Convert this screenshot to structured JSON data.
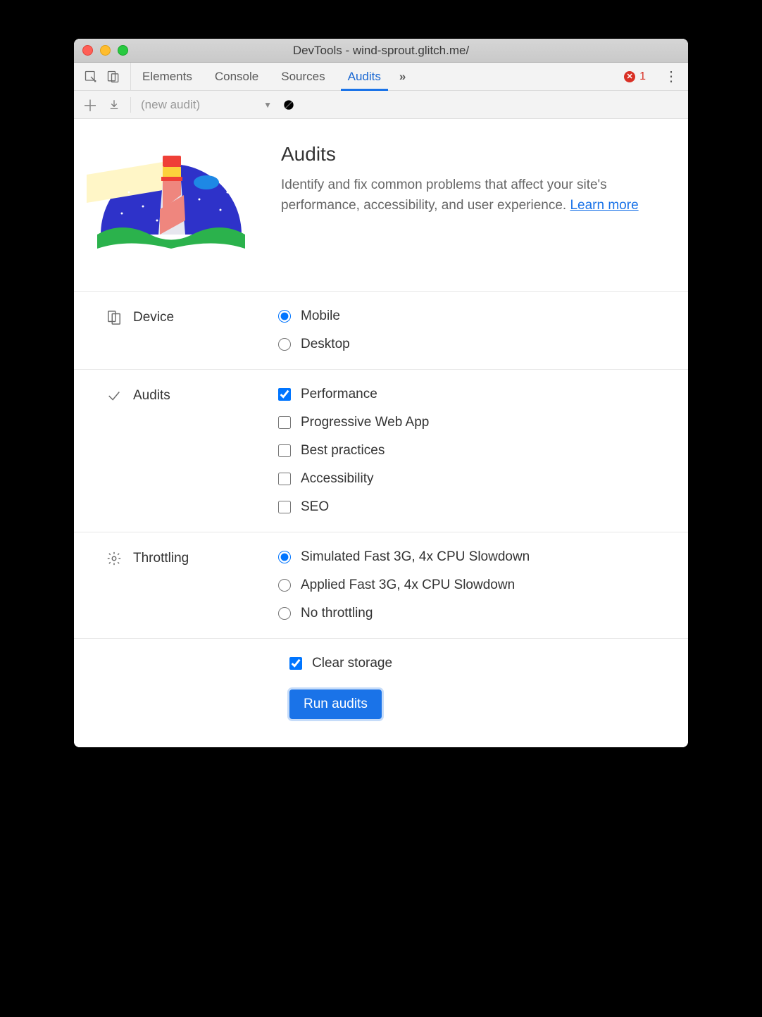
{
  "window": {
    "title": "DevTools - wind-sprout.glitch.me/"
  },
  "tabbar": {
    "tabs": [
      {
        "label": "Elements",
        "active": false
      },
      {
        "label": "Console",
        "active": false
      },
      {
        "label": "Sources",
        "active": false
      },
      {
        "label": "Audits",
        "active": true
      }
    ],
    "errors_count": "1"
  },
  "subbar": {
    "select_label": "(new audit)"
  },
  "hero": {
    "title": "Audits",
    "description": "Identify and fix common problems that affect your site's performance, accessibility, and user experience. ",
    "learn_more": "Learn more"
  },
  "device": {
    "label": "Device",
    "options": [
      {
        "label": "Mobile",
        "checked": true
      },
      {
        "label": "Desktop",
        "checked": false
      }
    ]
  },
  "audits": {
    "label": "Audits",
    "options": [
      {
        "label": "Performance",
        "checked": true
      },
      {
        "label": "Progressive Web App",
        "checked": false
      },
      {
        "label": "Best practices",
        "checked": false
      },
      {
        "label": "Accessibility",
        "checked": false
      },
      {
        "label": "SEO",
        "checked": false
      }
    ]
  },
  "throttling": {
    "label": "Throttling",
    "options": [
      {
        "label": "Simulated Fast 3G, 4x CPU Slowdown",
        "checked": true
      },
      {
        "label": "Applied Fast 3G, 4x CPU Slowdown",
        "checked": false
      },
      {
        "label": "No throttling",
        "checked": false
      }
    ]
  },
  "clear_storage": {
    "label": "Clear storage",
    "checked": true
  },
  "run_button": "Run audits"
}
